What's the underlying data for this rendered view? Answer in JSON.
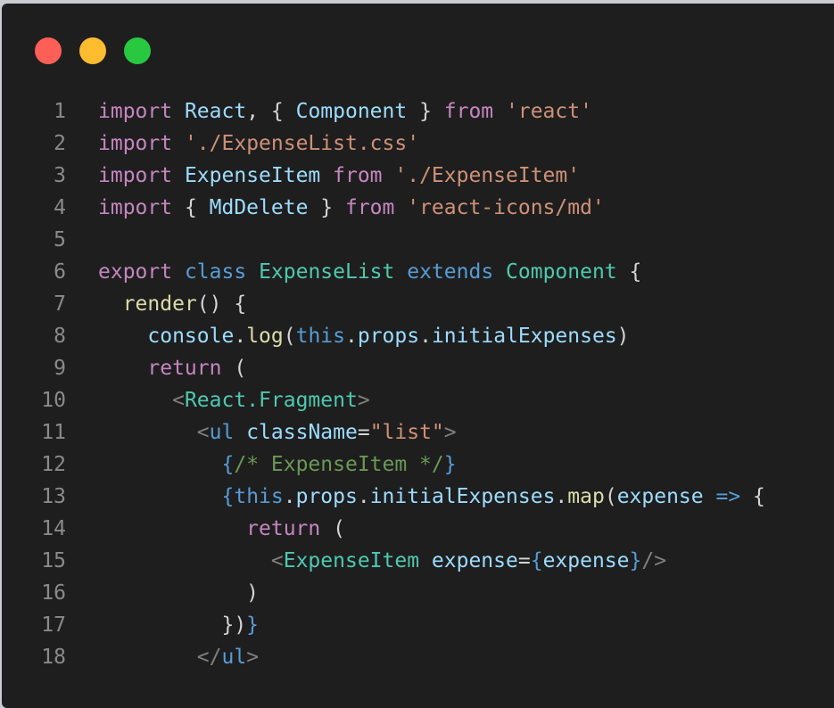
{
  "window": {
    "traffic_lights": [
      {
        "name": "close-icon",
        "color": "#ff5f57"
      },
      {
        "name": "minimize-icon",
        "color": "#febc2e"
      },
      {
        "name": "zoom-icon",
        "color": "#28c840"
      }
    ]
  },
  "theme": {
    "background": "#1e1e1e",
    "line_number": "#8a8a8a",
    "keyword_purple": "#c586c0",
    "keyword_blue": "#569cd6",
    "identifier": "#9cdcfe",
    "type": "#4ec9b0",
    "string": "#ce9178",
    "function": "#dcdcaa",
    "comment": "#6a9955",
    "punct": "#d4d4d4",
    "tag_bracket": "#808080"
  },
  "code": {
    "lines": [
      {
        "n": "1",
        "tokens": [
          [
            "import",
            "kp"
          ],
          [
            " ",
            "p"
          ],
          [
            "React",
            "id"
          ],
          [
            ", { ",
            "p"
          ],
          [
            "Component",
            "id"
          ],
          [
            " } ",
            "p"
          ],
          [
            "from",
            "kp"
          ],
          [
            " ",
            "p"
          ],
          [
            "'react'",
            "s"
          ]
        ]
      },
      {
        "n": "2",
        "tokens": [
          [
            "import",
            "kp"
          ],
          [
            " ",
            "p"
          ],
          [
            "'./ExpenseList.css'",
            "s"
          ]
        ]
      },
      {
        "n": "3",
        "tokens": [
          [
            "import",
            "kp"
          ],
          [
            " ",
            "p"
          ],
          [
            "ExpenseItem",
            "id"
          ],
          [
            " ",
            "p"
          ],
          [
            "from",
            "kp"
          ],
          [
            " ",
            "p"
          ],
          [
            "'./ExpenseItem'",
            "s"
          ]
        ]
      },
      {
        "n": "4",
        "tokens": [
          [
            "import",
            "kp"
          ],
          [
            " { ",
            "p"
          ],
          [
            "MdDelete",
            "id"
          ],
          [
            " } ",
            "p"
          ],
          [
            "from",
            "kp"
          ],
          [
            " ",
            "p"
          ],
          [
            "'react-icons/md'",
            "s"
          ]
        ]
      },
      {
        "n": "5",
        "tokens": []
      },
      {
        "n": "6",
        "tokens": [
          [
            "export",
            "kp"
          ],
          [
            " ",
            "p"
          ],
          [
            "class",
            "kb"
          ],
          [
            " ",
            "p"
          ],
          [
            "ExpenseList",
            "t"
          ],
          [
            " ",
            "p"
          ],
          [
            "extends",
            "kb"
          ],
          [
            " ",
            "p"
          ],
          [
            "Component",
            "t"
          ],
          [
            " {",
            "p"
          ]
        ]
      },
      {
        "n": "7",
        "tokens": [
          [
            "  ",
            "p"
          ],
          [
            "render",
            "f"
          ],
          [
            "() {",
            "p"
          ]
        ]
      },
      {
        "n": "8",
        "tokens": [
          [
            "    ",
            "p"
          ],
          [
            "console",
            "id"
          ],
          [
            ".",
            "p"
          ],
          [
            "log",
            "f"
          ],
          [
            "(",
            "p"
          ],
          [
            "this",
            "kb"
          ],
          [
            ".",
            "p"
          ],
          [
            "props",
            "id"
          ],
          [
            ".",
            "p"
          ],
          [
            "initialExpenses",
            "id"
          ],
          [
            ")",
            "p"
          ]
        ]
      },
      {
        "n": "9",
        "tokens": [
          [
            "    ",
            "p"
          ],
          [
            "return",
            "kp"
          ],
          [
            " (",
            "p"
          ]
        ]
      },
      {
        "n": "10",
        "tokens": [
          [
            "      ",
            "p"
          ],
          [
            "<",
            "tb"
          ],
          [
            "React.Fragment",
            "t"
          ],
          [
            ">",
            "tb"
          ]
        ]
      },
      {
        "n": "11",
        "tokens": [
          [
            "        ",
            "p"
          ],
          [
            "<",
            "tb"
          ],
          [
            "ul",
            "kb"
          ],
          [
            " ",
            "p"
          ],
          [
            "className",
            "id"
          ],
          [
            "=",
            "p"
          ],
          [
            "\"list\"",
            "s"
          ],
          [
            ">",
            "tb"
          ]
        ]
      },
      {
        "n": "12",
        "tokens": [
          [
            "          ",
            "p"
          ],
          [
            "{",
            "kb"
          ],
          [
            "/* ExpenseItem */",
            "c"
          ],
          [
            "}",
            "kb"
          ]
        ]
      },
      {
        "n": "13",
        "tokens": [
          [
            "          ",
            "p"
          ],
          [
            "{",
            "kb"
          ],
          [
            "this",
            "kb"
          ],
          [
            ".",
            "p"
          ],
          [
            "props",
            "id"
          ],
          [
            ".",
            "p"
          ],
          [
            "initialExpenses",
            "id"
          ],
          [
            ".",
            "p"
          ],
          [
            "map",
            "f"
          ],
          [
            "(",
            "p"
          ],
          [
            "expense",
            "id"
          ],
          [
            " ",
            "p"
          ],
          [
            "=>",
            "kb"
          ],
          [
            " {",
            "p"
          ]
        ]
      },
      {
        "n": "14",
        "tokens": [
          [
            "            ",
            "p"
          ],
          [
            "return",
            "kp"
          ],
          [
            " (",
            "p"
          ]
        ]
      },
      {
        "n": "15",
        "tokens": [
          [
            "              ",
            "p"
          ],
          [
            "<",
            "tb"
          ],
          [
            "ExpenseItem",
            "t"
          ],
          [
            " ",
            "p"
          ],
          [
            "expense",
            "id"
          ],
          [
            "=",
            "p"
          ],
          [
            "{",
            "kb"
          ],
          [
            "expense",
            "id"
          ],
          [
            "}",
            "kb"
          ],
          [
            "/>",
            "tb"
          ]
        ]
      },
      {
        "n": "16",
        "tokens": [
          [
            "            )",
            "p"
          ]
        ]
      },
      {
        "n": "17",
        "tokens": [
          [
            "          })",
            "p"
          ],
          [
            "}",
            "kb"
          ]
        ]
      },
      {
        "n": "18",
        "tokens": [
          [
            "        ",
            "p"
          ],
          [
            "</",
            "tb"
          ],
          [
            "ul",
            "kb"
          ],
          [
            ">",
            "tb"
          ]
        ]
      }
    ]
  }
}
